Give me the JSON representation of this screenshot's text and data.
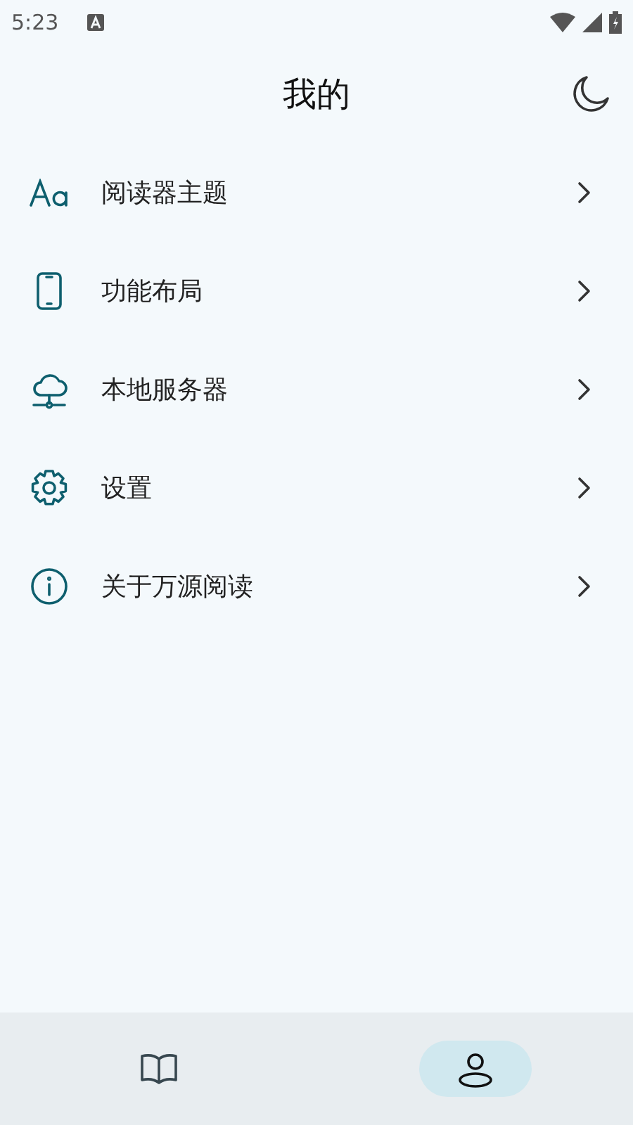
{
  "status_bar": {
    "time": "5:23"
  },
  "header": {
    "title": "我的"
  },
  "menu_items": [
    {
      "kind": "theme",
      "label": "阅读器主题"
    },
    {
      "kind": "phone",
      "label": "功能布局"
    },
    {
      "kind": "cloud",
      "label": "本地服务器"
    },
    {
      "kind": "gear",
      "label": "设置"
    },
    {
      "kind": "info",
      "label": "关于万源阅读"
    }
  ],
  "bottom_nav": [
    {
      "kind": "book",
      "selected": false
    },
    {
      "kind": "person",
      "selected": true
    }
  ]
}
